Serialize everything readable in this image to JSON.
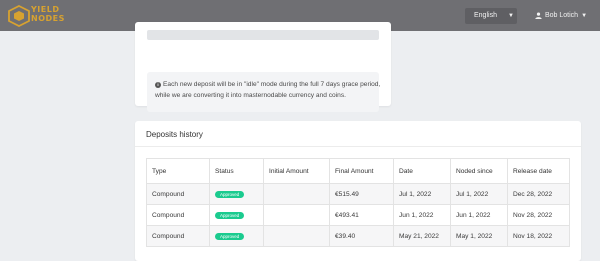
{
  "header": {
    "brand_line1": "YIELD",
    "brand_line2": "NODES",
    "language": "English",
    "user_name": "Bob Lotich",
    "brand_color": "#d7a230"
  },
  "notice": {
    "text": "Each new deposit will be in \"idle\" mode during the full 7 days grace period, while we are converting it into masternodable currency and coins."
  },
  "deposits": {
    "title": "Deposits history",
    "columns": [
      "Type",
      "Status",
      "Initial Amount",
      "Final Amount",
      "Date",
      "Noded since",
      "Release date"
    ],
    "rows": [
      {
        "type": "Compound",
        "status": "Approved",
        "initial_amount": "",
        "final_amount": "€515.49",
        "date": "Jul 1, 2022",
        "noded_since": "Jul 1, 2022",
        "release_date": "Dec 28, 2022"
      },
      {
        "type": "Compound",
        "status": "Approved",
        "initial_amount": "",
        "final_amount": "€493.41",
        "date": "Jun 1, 2022",
        "noded_since": "Jun 1, 2022",
        "release_date": "Nov 28, 2022"
      },
      {
        "type": "Compound",
        "status": "Approved",
        "initial_amount": "",
        "final_amount": "€39.40",
        "date": "May 21, 2022",
        "noded_since": "May 1, 2022",
        "release_date": "Nov 18, 2022"
      }
    ],
    "status_color": "#1bcb8f"
  }
}
